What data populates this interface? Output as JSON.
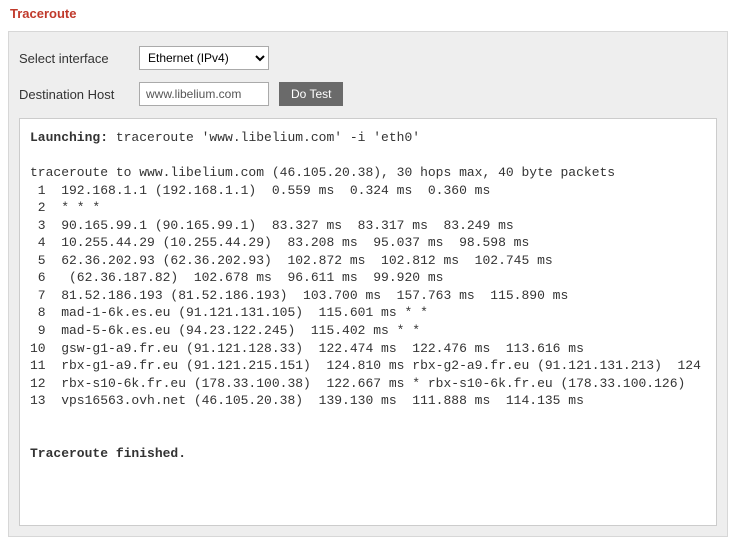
{
  "title": "Traceroute",
  "form": {
    "interface_label": "Select interface",
    "interface_selected": "Ethernet (IPv4)",
    "host_label": "Destination Host",
    "host_value": "www.libelium.com",
    "button_label": "Do Test"
  },
  "output": {
    "launching_label": "Launching:",
    "launching_cmd": " traceroute 'www.libelium.com' -i 'eth0'",
    "body": "traceroute to www.libelium.com (46.105.20.38), 30 hops max, 40 byte packets\n 1  192.168.1.1 (192.168.1.1)  0.559 ms  0.324 ms  0.360 ms\n 2  * * *\n 3  90.165.99.1 (90.165.99.1)  83.327 ms  83.317 ms  83.249 ms\n 4  10.255.44.29 (10.255.44.29)  83.208 ms  95.037 ms  98.598 ms\n 5  62.36.202.93 (62.36.202.93)  102.872 ms  102.812 ms  102.745 ms\n 6   (62.36.187.82)  102.678 ms  96.611 ms  99.920 ms\n 7  81.52.186.193 (81.52.186.193)  103.700 ms  157.763 ms  115.890 ms\n 8  mad-1-6k.es.eu (91.121.131.105)  115.601 ms * *\n 9  mad-5-6k.es.eu (94.23.122.245)  115.402 ms * *\n10  gsw-g1-a9.fr.eu (91.121.128.33)  122.474 ms  122.476 ms  113.616 ms\n11  rbx-g1-a9.fr.eu (91.121.215.151)  124.810 ms rbx-g2-a9.fr.eu (91.121.131.213)  124\n12  rbx-s10-6k.fr.eu (178.33.100.38)  122.667 ms * rbx-s10-6k.fr.eu (178.33.100.126)  \n13  vps16563.ovh.net (46.105.20.38)  139.130 ms  111.888 ms  114.135 ms",
    "finished_label": "Traceroute finished."
  }
}
